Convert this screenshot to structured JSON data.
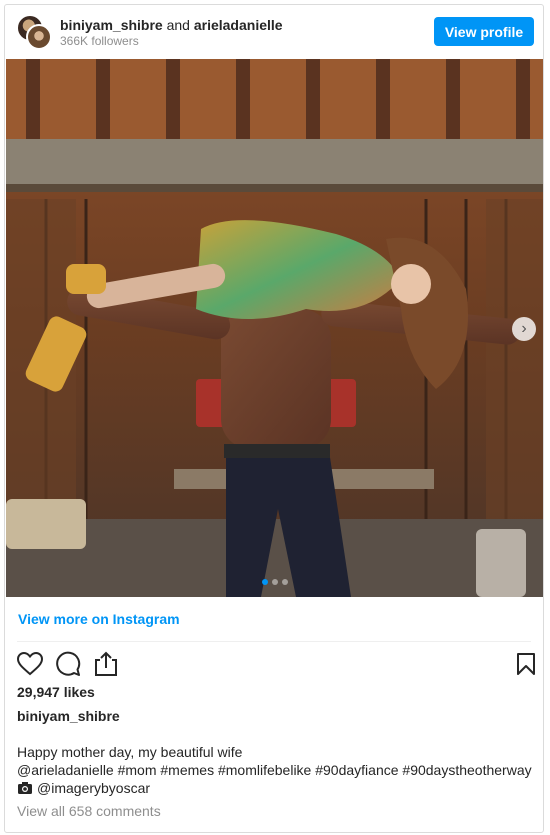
{
  "header": {
    "user1": "biniyam_shibre",
    "connector": "and",
    "user2": "arieladanielle",
    "followers": "366K followers",
    "view_profile_label": "View profile"
  },
  "post": {
    "view_more_label": "View more on Instagram",
    "likes": "29,947 likes",
    "author": "biniyam_shibre",
    "caption_line1": "Happy mother day, my beautiful wife",
    "caption_line2": "@arieladanielle #mom #memes #momlifebelike #90dayfiance #90daystheotherway",
    "caption_line3": "@imagerybyoscar",
    "comments_label": "View all 658 comments",
    "carousel": {
      "count": 3,
      "active": 1
    }
  },
  "icons": [
    "heart-icon",
    "comment-icon",
    "share-icon",
    "bookmark-icon",
    "camera-icon",
    "chevron-right-icon"
  ],
  "colors": {
    "accent": "#0095f6",
    "muted": "#8e8e8e",
    "text": "#262626"
  }
}
